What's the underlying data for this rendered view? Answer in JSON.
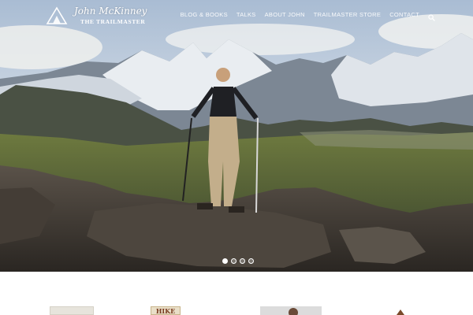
{
  "site": {
    "logo_name": "John McKinney",
    "logo_tagline": "THE TRAILMASTER",
    "logo_icon": "mountain-icon"
  },
  "nav": {
    "items": [
      {
        "label": "BLOG & BOOKS"
      },
      {
        "label": "TALKS"
      },
      {
        "label": "ABOUT JOHN"
      },
      {
        "label": "TRAILMASTER STORE"
      },
      {
        "label": "CONTACT"
      }
    ],
    "search_icon": "search-icon"
  },
  "hero": {
    "slides_count": 4,
    "active_slide": 1
  },
  "cards": {
    "book2_title": "HIKE"
  },
  "colors": {
    "nav_text": "#ffffff",
    "page_bg": "#ffffff"
  }
}
